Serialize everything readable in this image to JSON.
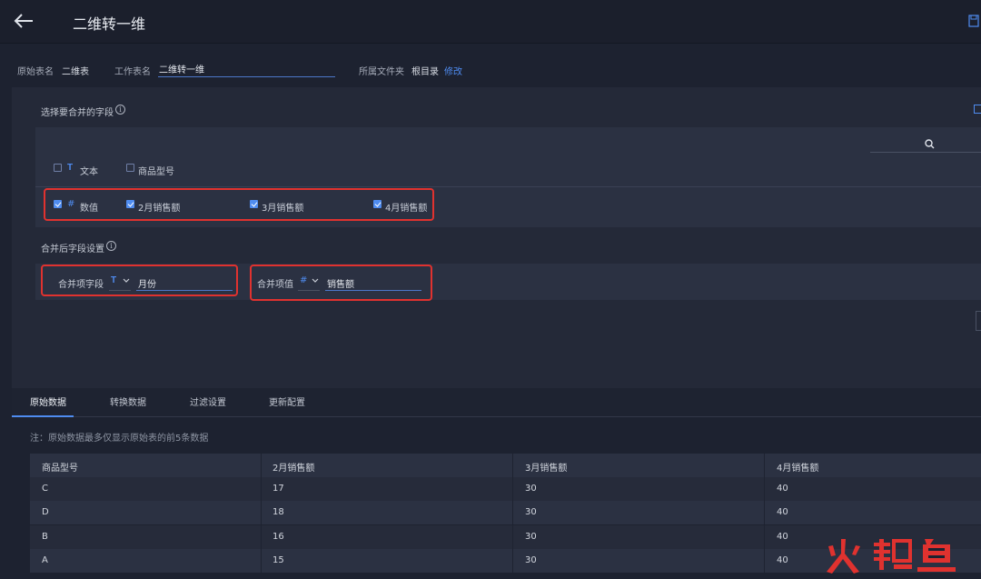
{
  "header": {
    "title": "二维转一维",
    "back_icon": "arrow-left-icon",
    "save_icon": "save-icon"
  },
  "meta": {
    "source_label": "原始表名",
    "source_value": "二维表",
    "work_label": "工作表名",
    "work_value": "二维转一维",
    "folder_label": "所属文件夹",
    "folder_value": "根目录",
    "edit_link": "修改"
  },
  "merge_fields": {
    "section_label": "选择要合并的字段",
    "info": "i",
    "text_group": {
      "type": "T",
      "label": "文本",
      "checked": false
    },
    "text_fields": [
      {
        "label": "商品型号",
        "checked": false
      }
    ],
    "num_group": {
      "type": "#",
      "label": "数值",
      "checked": true
    },
    "num_fields": [
      {
        "label": "2月销售额",
        "checked": true
      },
      {
        "label": "3月销售额",
        "checked": true
      },
      {
        "label": "4月销售额",
        "checked": true
      }
    ]
  },
  "after_merge": {
    "section_label": "合并后字段设置",
    "info": "i",
    "item_field": {
      "label": "合并项字段",
      "type": "T",
      "value": "月份"
    },
    "value_field": {
      "label": "合并项值",
      "type": "#",
      "value": "销售额"
    }
  },
  "tabs": [
    {
      "label": "原始数据",
      "active": true
    },
    {
      "label": "转换数据",
      "active": false
    },
    {
      "label": "过滤设置",
      "active": false
    },
    {
      "label": "更新配置",
      "active": false
    }
  ],
  "note": "注：原始数据最多仅显示原始表的前5条数据",
  "table": {
    "headers": [
      "商品型号",
      "2月销售额",
      "3月销售额",
      "4月销售额"
    ],
    "rows": [
      [
        "C",
        "17",
        "30",
        "40"
      ],
      [
        "D",
        "18",
        "30",
        "40"
      ],
      [
        "B",
        "16",
        "30",
        "40"
      ],
      [
        "A",
        "15",
        "30",
        "40"
      ]
    ]
  },
  "watermark": {
    "text": "火鲤鱼",
    "color": "#e0322f"
  },
  "colors": {
    "accent": "#4f8cf0",
    "highlight": "#e0322f",
    "background": "#1d2230"
  }
}
